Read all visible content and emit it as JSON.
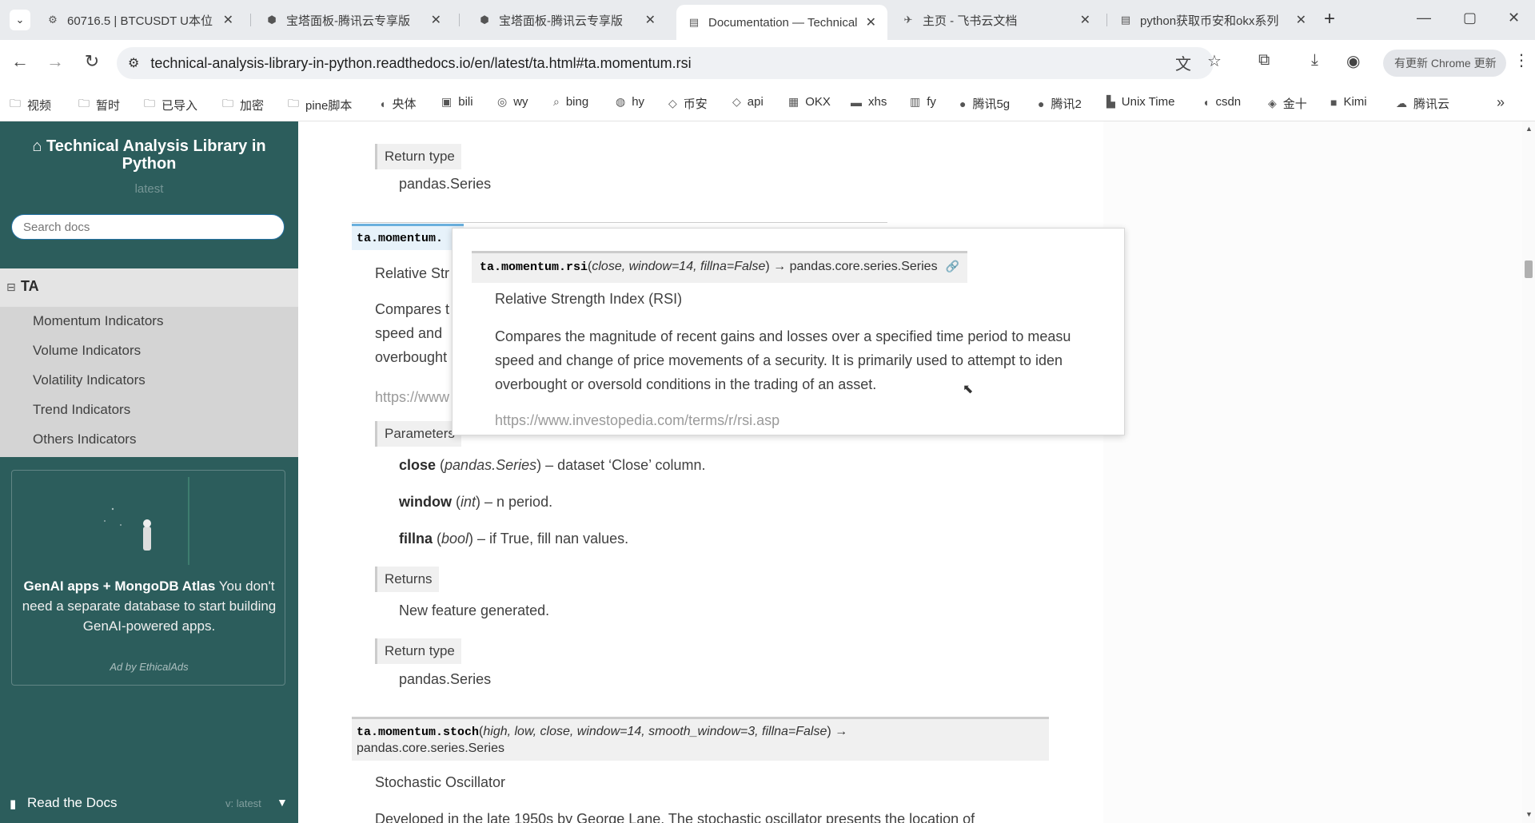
{
  "browser": {
    "tabs": [
      {
        "title": "60716.5 | BTCUSDT U本位",
        "icon": "gear-icon"
      },
      {
        "title": "宝塔面板-腾讯云专享版",
        "icon": "panel-icon"
      },
      {
        "title": "宝塔面板-腾讯云专享版",
        "icon": "panel-icon"
      },
      {
        "title": "Documentation — Technical Analysis Library",
        "icon": "doc-icon",
        "active": true
      },
      {
        "title": "主页 - 飞书云文档",
        "icon": "feishu-icon"
      },
      {
        "title": "python获取币安和okx系列",
        "icon": "doc-icon"
      }
    ],
    "new_tab": "+",
    "url": "technical-analysis-library-in-python.readthedocs.io/en/latest/ta.html#ta.momentum.rsi",
    "profile_label": "有更新 Chrome 更新",
    "bookmarks": [
      {
        "label": "视频",
        "icon": "folder-icon"
      },
      {
        "label": "暂时",
        "icon": "folder-icon"
      },
      {
        "label": "已导入",
        "icon": "folder-icon"
      },
      {
        "label": "加密",
        "icon": "folder-icon"
      },
      {
        "label": "pine脚本",
        "icon": "folder-icon"
      },
      {
        "label": "央体",
        "icon": "c-icon"
      },
      {
        "label": "bili",
        "icon": "tv-icon"
      },
      {
        "label": "wy",
        "icon": "music-icon"
      },
      {
        "label": "bing",
        "icon": "search-icon"
      },
      {
        "label": "hy",
        "icon": "globe-icon"
      },
      {
        "label": "币安",
        "icon": "binance-icon"
      },
      {
        "label": "api",
        "icon": "binance-icon"
      },
      {
        "label": "OKX",
        "icon": "okx-icon"
      },
      {
        "label": "xhs",
        "icon": "xhs-icon"
      },
      {
        "label": "fy",
        "icon": "translate-icon"
      },
      {
        "label": "腾讯5g",
        "icon": "penguin-icon"
      },
      {
        "label": "腾讯2",
        "icon": "penguin-icon"
      },
      {
        "label": "Unix Time",
        "icon": "clock-icon"
      },
      {
        "label": "csdn",
        "icon": "c-icon"
      },
      {
        "label": "金十",
        "icon": "gold-icon"
      },
      {
        "label": "Kimi",
        "icon": "kimi-icon"
      },
      {
        "label": "腾讯云",
        "icon": "cloud-icon"
      }
    ]
  },
  "sidebar": {
    "title": "Technical Analysis Library in Python",
    "version": "latest",
    "search_placeholder": "Search docs",
    "toc_head": "TA",
    "toc_expand": "⊟",
    "items": [
      {
        "label": "Momentum Indicators"
      },
      {
        "label": "Volume Indicators"
      },
      {
        "label": "Volatility Indicators"
      },
      {
        "label": "Trend Indicators"
      },
      {
        "label": "Others Indicators"
      }
    ],
    "ad": {
      "bold1": "GenAI apps + MongoDB Atlas",
      "text": " You don't need a separate database to start building GenAI-powered apps.",
      "footer": "Ad by EthicalAds"
    },
    "rtd_label": "Read the Docs",
    "rtd_version": "v: latest"
  },
  "content": {
    "return_type_label": "Return type",
    "return_type_value": "pandas.Series",
    "rsi_sig_prefix": "ta.momentum.",
    "rsi_title_partial": "Relative Str",
    "rsi_desc_partial": [
      "Compares t",
      "speed and",
      "overbought"
    ],
    "rsi_link_partial": "https://www",
    "parameters_label": "Parameters",
    "params": [
      {
        "name": "close",
        "type": "pandas.Series",
        "desc": " – dataset ‘Close’ column."
      },
      {
        "name": "window",
        "type": "int",
        "desc": " – n period."
      },
      {
        "name": "fillna",
        "type": "bool",
        "desc": " – if True, fill nan values."
      }
    ],
    "returns_label": "Returns",
    "returns_value": "New feature generated.",
    "return_type_label_2": "Return type",
    "return_type_value_2": "pandas.Series",
    "stoch_sig": {
      "name": "ta.momentum.stoch",
      "params": "high, low, close, window=14, smooth_window=3, fillna=False",
      "ret": "pandas.core.series.Series"
    },
    "stoch_title": "Stochastic Oscillator",
    "stoch_desc_partial": "Developed in the late 1950s by George Lane. The stochastic oscillator presents the location of"
  },
  "popup": {
    "sig_name": "ta.momentum.rsi",
    "sig_params": "close, window=14, fillna=False",
    "sig_ret": "pandas.core.series.Series",
    "title": "Relative Strength Index (RSI)",
    "desc": [
      "Compares the magnitude of recent gains and losses over a specified time period to measu",
      "speed and change of price movements of a security. It is primarily used to attempt to iden",
      "overbought or oversold conditions in the trading of an asset."
    ],
    "link": "https://www.investopedia.com/terms/r/rsi.asp"
  }
}
